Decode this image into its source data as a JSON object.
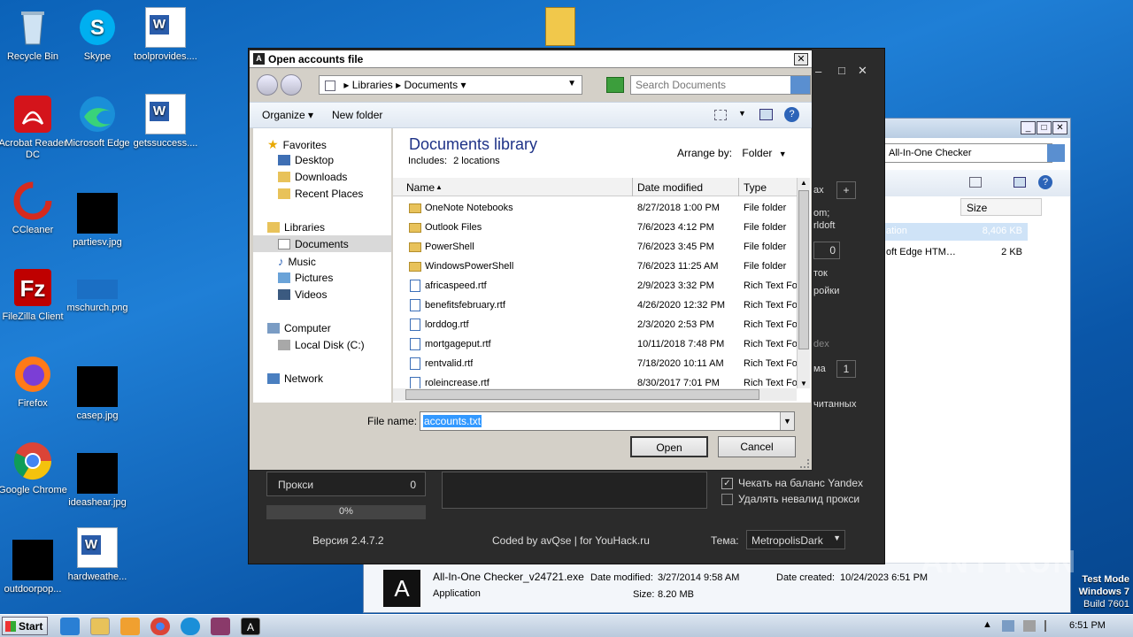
{
  "desktop": {
    "icons": [
      {
        "label": "Recycle Bin"
      },
      {
        "label": "Skype"
      },
      {
        "label": "toolprovides...."
      },
      {
        "label": "Acrobat Reader DC"
      },
      {
        "label": "Microsoft Edge"
      },
      {
        "label": "getssuccess...."
      },
      {
        "label": "CCleaner"
      },
      {
        "label": "partiesv.jpg"
      },
      {
        "label": "FileZilla Client"
      },
      {
        "label": "mschurch.png"
      },
      {
        "label": "Firefox"
      },
      {
        "label": "casep.jpg"
      },
      {
        "label": "Google Chrome"
      },
      {
        "label": "ideashear.jpg"
      },
      {
        "label": "outdoorpop..."
      },
      {
        "label": "hardweathe..."
      }
    ]
  },
  "bg_explorer": {
    "search_text": "All-In-One Checker",
    "col_size": "Size",
    "rows": [
      {
        "name": "ation",
        "size": "8,406 KB"
      },
      {
        "name": "oft Edge HTM…",
        "size": "2 KB"
      }
    ],
    "details": {
      "name": "All-In-One Checker_v24721.exe",
      "type": "Application",
      "date_modified_label": "Date modified:",
      "date_modified": "3/27/2014 9:58 AM",
      "size_label": "Size:",
      "size": "8.20 MB",
      "date_created_label": "Date created:",
      "date_created": "10/24/2023 6:51 PM"
    }
  },
  "checker_app": {
    "right_bits": [
      "ax",
      "+",
      "om;",
      "rldoft",
      "0",
      "ток",
      "ройки",
      "dex",
      "ма",
      "1",
      "читанных"
    ],
    "proxy_label": "Прокси",
    "proxy_count": "0",
    "progress_text": "0%",
    "progress": 0,
    "check_yandex": "Чекать на баланс Yandex",
    "delete_invalid": "Удалять невалид прокси",
    "version": "Версия 2.4.7.2",
    "coded_by": "Coded by avQse | for YouHack.ru",
    "theme_label": "Тема:",
    "theme_value": "MetropolisDark"
  },
  "dialog": {
    "title": "Open accounts file",
    "address": [
      "Libraries",
      "Documents"
    ],
    "search_placeholder": "Search Documents",
    "organize": "Organize",
    "new_folder": "New folder",
    "library_title": "Documents library",
    "includes": "Includes:",
    "includes_link": "2 locations",
    "arrange_by": "Arrange by:",
    "arrange_value": "Folder",
    "columns": {
      "name": "Name",
      "date": "Date modified",
      "type": "Type"
    },
    "nav": {
      "favorites": "Favorites",
      "desktop": "Desktop",
      "downloads": "Downloads",
      "recent": "Recent Places",
      "libraries": "Libraries",
      "documents": "Documents",
      "music": "Music",
      "pictures": "Pictures",
      "videos": "Videos",
      "computer": "Computer",
      "local_disk": "Local Disk (C:)",
      "network": "Network"
    },
    "files": [
      {
        "name": "OneNote Notebooks",
        "date": "8/27/2018 1:00 PM",
        "type": "File folder",
        "kind": "folder"
      },
      {
        "name": "Outlook Files",
        "date": "7/6/2023 4:12 PM",
        "type": "File folder",
        "kind": "folder"
      },
      {
        "name": "PowerShell",
        "date": "7/6/2023 3:45 PM",
        "type": "File folder",
        "kind": "folder"
      },
      {
        "name": "WindowsPowerShell",
        "date": "7/6/2023 11:25 AM",
        "type": "File folder",
        "kind": "folder"
      },
      {
        "name": "africaspeed.rtf",
        "date": "2/9/2023 3:32 PM",
        "type": "Rich Text Fo",
        "kind": "rtf"
      },
      {
        "name": "benefitsfebruary.rtf",
        "date": "4/26/2020 12:32 PM",
        "type": "Rich Text Fo",
        "kind": "rtf"
      },
      {
        "name": "lorddog.rtf",
        "date": "2/3/2020 2:53 PM",
        "type": "Rich Text Fo",
        "kind": "rtf"
      },
      {
        "name": "mortgageput.rtf",
        "date": "10/11/2018 7:48 PM",
        "type": "Rich Text Fo",
        "kind": "rtf"
      },
      {
        "name": "rentvalid.rtf",
        "date": "7/18/2020 10:11 AM",
        "type": "Rich Text Fo",
        "kind": "rtf"
      },
      {
        "name": "roleincrease.rtf",
        "date": "8/30/2017 7:01 PM",
        "type": "Rich Text Fo",
        "kind": "rtf"
      }
    ],
    "file_name_label": "File name:",
    "file_name_value": "accounts.txt",
    "open": "Open",
    "cancel": "Cancel"
  },
  "taskbar": {
    "start": "Start",
    "time": "6:51 PM"
  },
  "watermark": {
    "line1": "Test Mode",
    "line2": "Windows 7",
    "line3": "Build 7601",
    "brand": "ANY RUN"
  }
}
